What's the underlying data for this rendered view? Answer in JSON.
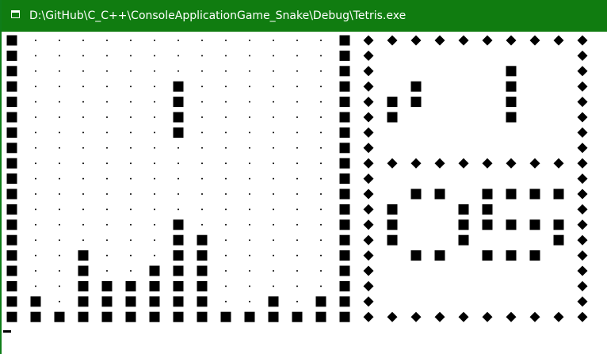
{
  "window": {
    "title": "D:\\GitHub\\C_C++\\ConsoleApplicationGame_Snake\\Debug\\Tetris.exe",
    "titlebar_color": "#107c10"
  },
  "board": {
    "cols": 14,
    "rows": 12,
    "empty_cell": "·",
    "filled_cell": "■",
    "wall_cell": "■",
    "cells": [
      [
        "",
        "",
        "",
        "",
        "",
        "",
        "",
        "",
        "",
        "",
        "",
        "",
        "",
        ""
      ],
      [
        "",
        "",
        "",
        "",
        "",
        "",
        "",
        "",
        "",
        "",
        "",
        "",
        "",
        ""
      ],
      [
        "",
        "",
        "",
        "",
        "",
        "",
        "X",
        "",
        "",
        "",
        "",
        "",
        "",
        ""
      ],
      [
        "",
        "",
        "",
        "",
        "",
        "",
        "X",
        "",
        "",
        "",
        "",
        "",
        "",
        ""
      ],
      [
        "",
        "",
        "",
        "",
        "",
        "",
        "X",
        "",
        "",
        "",
        "",
        "",
        "",
        ""
      ],
      [
        "",
        "",
        "",
        "",
        "",
        "",
        "X",
        "",
        "",
        "",
        "",
        "",
        "",
        ""
      ],
      [
        "",
        "",
        "",
        "",
        "",
        "",
        "",
        "",
        "",
        "",
        "",
        "",
        "",
        ""
      ],
      [
        "",
        "",
        "",
        "",
        "",
        "",
        "",
        "",
        "",
        "",
        "",
        "",
        "",
        ""
      ],
      [
        "",
        "",
        "",
        "",
        "",
        "",
        "",
        "",
        "",
        "",
        "",
        "",
        "",
        ""
      ],
      [
        "",
        "",
        "",
        "",
        "",
        "",
        "",
        "",
        "",
        "",
        "",
        "",
        "",
        ""
      ],
      [
        "",
        "",
        "",
        "",
        "",
        "",
        "",
        "",
        "",
        "",
        "",
        "",
        "",
        ""
      ],
      [
        "",
        "",
        "",
        "",
        "",
        "",
        "",
        "",
        "",
        "",
        "",
        "",
        "",
        ""
      ]
    ]
  },
  "side_panel": {
    "border_glyph": "◆",
    "next_piece_glyph": "■",
    "score_glyph": "■"
  },
  "colors": {
    "background": "#ffffff",
    "foreground": "#000000"
  }
}
